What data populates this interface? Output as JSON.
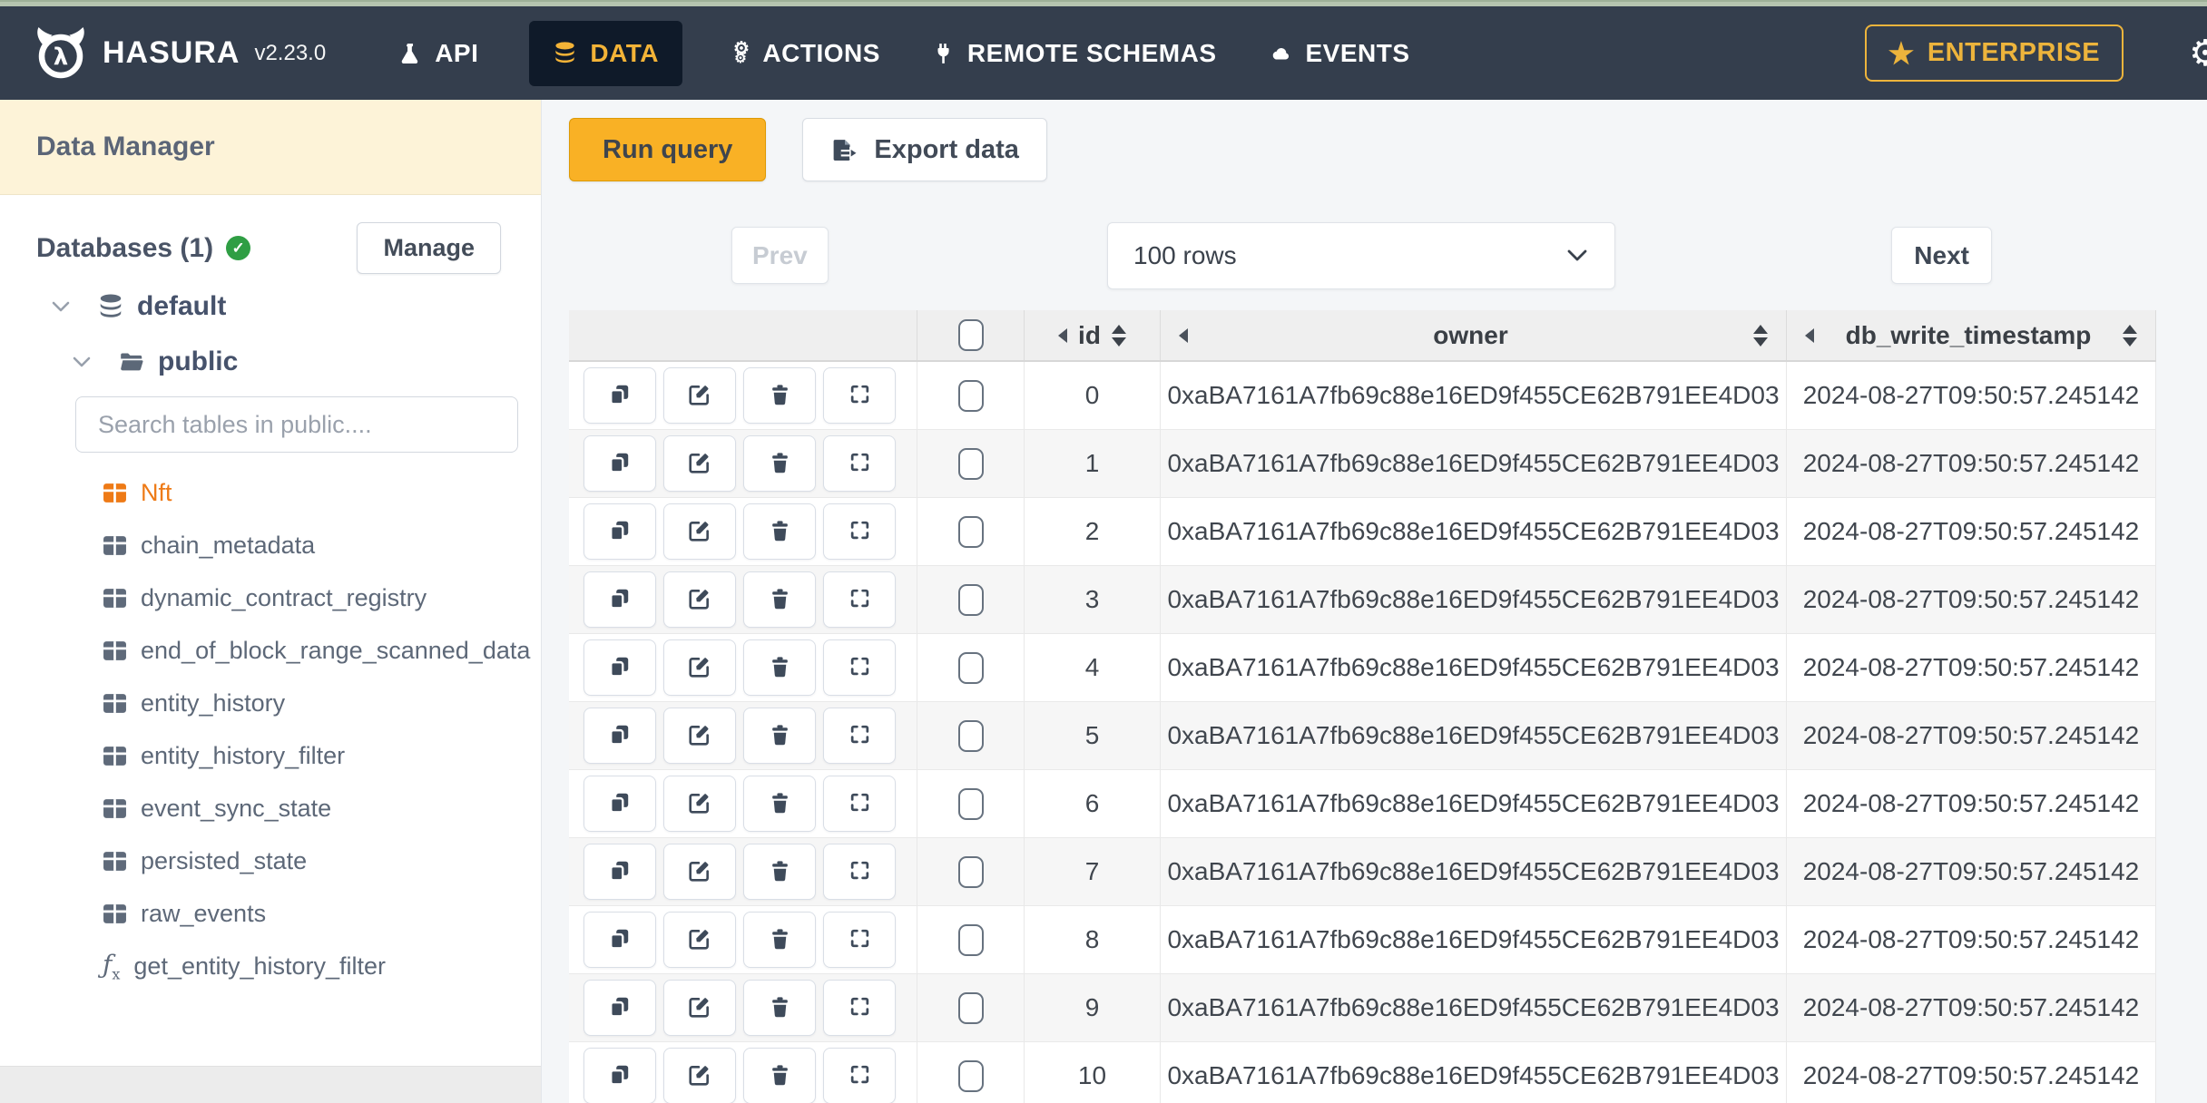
{
  "page": {
    "navbar_bg": "#343e4d",
    "active_tab_bg": "#0f1a29",
    "accent_yellow": "#f3b337",
    "cream_header_bg": "#fdf3d8",
    "active_table_orange": "#ee7a16",
    "status_green": "#2f9e44",
    "main_bg": "#f4f6f8"
  },
  "navbar": {
    "brand": "HASURA",
    "version": "v2.23.0",
    "items": [
      {
        "label": "API",
        "icon": "flask-icon",
        "active": false
      },
      {
        "label": "DATA",
        "icon": "database-icon",
        "active": true
      },
      {
        "label": "ACTIONS",
        "icon": "gears-icon",
        "active": false
      },
      {
        "label": "REMOTE SCHEMAS",
        "icon": "plug-icon",
        "active": false
      },
      {
        "label": "EVENTS",
        "icon": "cloud-icon",
        "active": false
      }
    ],
    "enterprise": {
      "label": "ENTERPRISE",
      "icon": "star-icon"
    },
    "settings_icon": "gear-icon"
  },
  "sidebar": {
    "title": "Data Manager",
    "databases_label": "Databases (1)",
    "databases_status_icon": "check-circle-icon",
    "manage_label": "Manage",
    "tree": {
      "database": "default",
      "schema": "public"
    },
    "search_placeholder": "Search tables in public....",
    "tables": [
      {
        "name": "Nft",
        "active": true
      },
      {
        "name": "chain_metadata",
        "active": false
      },
      {
        "name": "dynamic_contract_registry",
        "active": false
      },
      {
        "name": "end_of_block_range_scanned_data",
        "active": false
      },
      {
        "name": "entity_history",
        "active": false
      },
      {
        "name": "entity_history_filter",
        "active": false
      },
      {
        "name": "event_sync_state",
        "active": false
      },
      {
        "name": "persisted_state",
        "active": false
      },
      {
        "name": "raw_events",
        "active": false
      }
    ],
    "functions": [
      {
        "name": "get_entity_history_filter"
      }
    ]
  },
  "toolbar": {
    "run_query_label": "Run query",
    "export_label": "Export data",
    "export_icon": "export-icon"
  },
  "pagination": {
    "prev_label": "Prev",
    "rows_value": "100 rows",
    "next_label": "Next"
  },
  "table": {
    "columns": [
      {
        "label": "id"
      },
      {
        "label": "owner"
      },
      {
        "label": "db_write_timestamp"
      }
    ],
    "row_actions": [
      "copy-icon",
      "edit-icon",
      "delete-icon",
      "expand-icon"
    ],
    "rows": [
      {
        "id": "0",
        "owner": "0xaBA7161A7fb69c88e16ED9f455CE62B791EE4D03",
        "db_write_timestamp": "2024-08-27T09:50:57.245142"
      },
      {
        "id": "1",
        "owner": "0xaBA7161A7fb69c88e16ED9f455CE62B791EE4D03",
        "db_write_timestamp": "2024-08-27T09:50:57.245142"
      },
      {
        "id": "2",
        "owner": "0xaBA7161A7fb69c88e16ED9f455CE62B791EE4D03",
        "db_write_timestamp": "2024-08-27T09:50:57.245142"
      },
      {
        "id": "3",
        "owner": "0xaBA7161A7fb69c88e16ED9f455CE62B791EE4D03",
        "db_write_timestamp": "2024-08-27T09:50:57.245142"
      },
      {
        "id": "4",
        "owner": "0xaBA7161A7fb69c88e16ED9f455CE62B791EE4D03",
        "db_write_timestamp": "2024-08-27T09:50:57.245142"
      },
      {
        "id": "5",
        "owner": "0xaBA7161A7fb69c88e16ED9f455CE62B791EE4D03",
        "db_write_timestamp": "2024-08-27T09:50:57.245142"
      },
      {
        "id": "6",
        "owner": "0xaBA7161A7fb69c88e16ED9f455CE62B791EE4D03",
        "db_write_timestamp": "2024-08-27T09:50:57.245142"
      },
      {
        "id": "7",
        "owner": "0xaBA7161A7fb69c88e16ED9f455CE62B791EE4D03",
        "db_write_timestamp": "2024-08-27T09:50:57.245142"
      },
      {
        "id": "8",
        "owner": "0xaBA7161A7fb69c88e16ED9f455CE62B791EE4D03",
        "db_write_timestamp": "2024-08-27T09:50:57.245142"
      },
      {
        "id": "9",
        "owner": "0xaBA7161A7fb69c88e16ED9f455CE62B791EE4D03",
        "db_write_timestamp": "2024-08-27T09:50:57.245142"
      },
      {
        "id": "10",
        "owner": "0xaBA7161A7fb69c88e16ED9f455CE62B791EE4D03",
        "db_write_timestamp": "2024-08-27T09:50:57.245142"
      }
    ]
  }
}
